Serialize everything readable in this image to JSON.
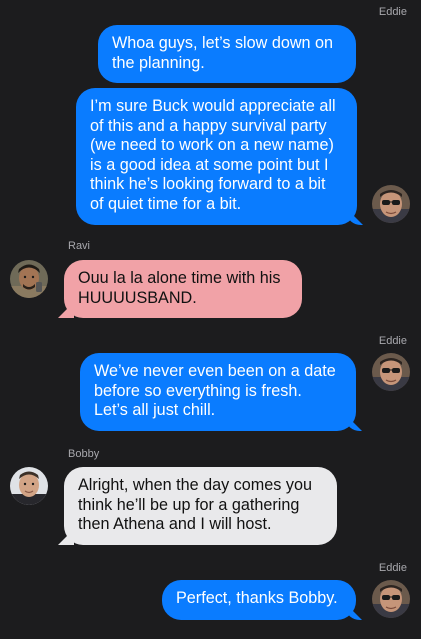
{
  "conversation": {
    "messages": [
      {
        "sender": "Eddie",
        "direction": "outgoing",
        "lines": [
          "Whoa guys, let’s slow down on",
          "the planning."
        ]
      },
      {
        "sender": "Eddie",
        "direction": "outgoing",
        "lines": [
          "I’m sure Buck would appreciate all",
          "of this and a happy survival party",
          "(we need to work on a new name)",
          "is a good idea at some point but I",
          "think he’s looking forward to a bit",
          "of quiet time for a bit."
        ]
      },
      {
        "sender": "Ravi",
        "direction": "incoming",
        "lines": [
          "Ouu la la alone time with his",
          "HUUUUSBAND."
        ]
      },
      {
        "sender": "Eddie",
        "direction": "outgoing",
        "lines": [
          "We’ve never even been on a date",
          "before so everything is fresh.",
          "Let’s all just chill."
        ]
      },
      {
        "sender": "Bobby",
        "direction": "incoming",
        "lines": [
          "Alright, when the day comes you",
          "think he’ll be up for a gathering",
          "then Athena and I will host."
        ]
      },
      {
        "sender": "Eddie",
        "direction": "outgoing",
        "lines": [
          "Perfect, thanks Bobby."
        ]
      }
    ],
    "names": {
      "eddie_1": "Eddie",
      "ravi": "Ravi",
      "eddie_2": "Eddie",
      "bobby": "Bobby",
      "eddie_3": "Eddie"
    }
  },
  "colors": {
    "background": "#1c1c1e",
    "outgoing_bubble": "#0a7cff",
    "ravi_bubble": "#f1a2a7",
    "bobby_bubble": "#e9e9eb",
    "sender_label": "#a8a8ad"
  },
  "avatars": {
    "eddie": "eddie-avatar-photo",
    "ravi": "ravi-avatar-photo",
    "bobby": "bobby-avatar-photo"
  }
}
